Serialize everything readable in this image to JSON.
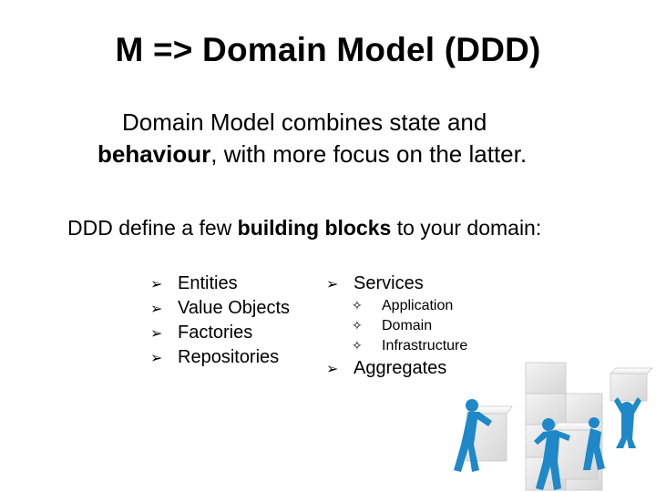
{
  "slide": {
    "title": "M => Domain Model (DDD)",
    "intro_line1": "Domain Model combines state and",
    "intro_bold": "behaviour",
    "intro_rest": ", with more focus on the latter.",
    "blocks_pre": "DDD define a few ",
    "blocks_bold": "building blocks",
    "blocks_post": " to your domain:",
    "col1": [
      "Entities",
      "Value Objects",
      "Factories",
      "Repositories"
    ],
    "col2_services": "Services",
    "col2_sub": [
      "Application",
      "Domain",
      "Infrastructure"
    ],
    "col2_aggregates": "Aggregates"
  },
  "icons": {
    "bullet": "arrowhead-bullet-icon",
    "sub_bullet": "four-point-star-icon",
    "illustration": "blue-figures-stacking-cubes-illustration"
  },
  "colors": {
    "text": "#000000",
    "figure_blue": "#1e88c8",
    "cube_grey": "#e6e6e6"
  }
}
